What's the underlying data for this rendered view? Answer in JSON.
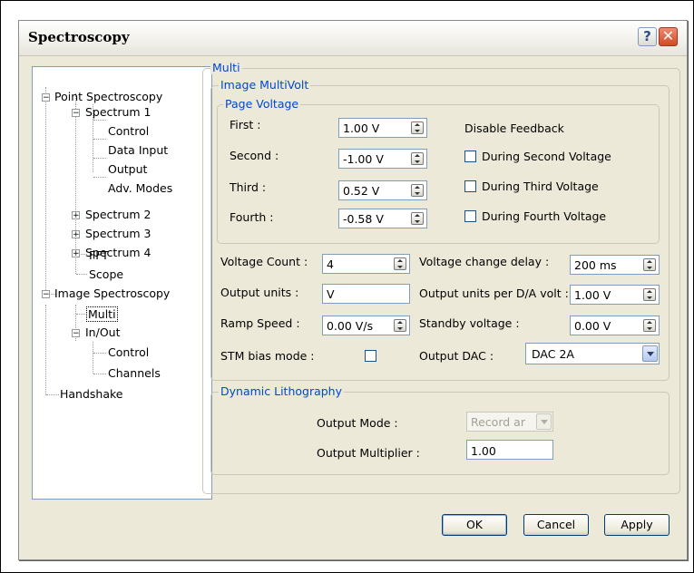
{
  "window": {
    "title": "Spectroscopy",
    "help_label": "?",
    "close_label": "✕"
  },
  "tree": {
    "point_spectroscopy": "Point Spectroscopy",
    "spectrum1": "Spectrum 1",
    "control": "Control",
    "data_input": "Data Input",
    "output": "Output",
    "adv_modes": "Adv. Modes",
    "spectrum2": "Spectrum 2",
    "spectrum3": "Spectrum 3",
    "spectrum4": "Spectrum 4",
    "fft": "FFT",
    "scope": "Scope",
    "image_spectroscopy": "Image Spectroscopy",
    "multi": "Multi",
    "in_out": "In/Out",
    "in_out_control": "Control",
    "channels": "Channels",
    "handshake": "Handshake"
  },
  "multi": {
    "group": "Multi",
    "image_multivolt": "Image MultiVolt",
    "page_voltage": "Page Voltage",
    "first_label": "First :",
    "first_value": "1.00 V",
    "second_label": "Second :",
    "second_value": "-1.00 V",
    "third_label": "Third :",
    "third_value": "0.52 V",
    "fourth_label": "Fourth :",
    "fourth_value": "-0.58 V",
    "disable_feedback": "Disable Feedback",
    "during_second": "During Second Voltage",
    "during_third": "During Third Voltage",
    "during_fourth": "During Fourth Voltage",
    "voltage_count_label": "Voltage Count :",
    "voltage_count_value": "4",
    "voltage_change_delay_label": "Voltage change delay :",
    "voltage_change_delay_value": "200 ms",
    "output_units_label": "Output units :",
    "output_units_value": "V",
    "output_units_per_da_label": "Output units per D/A volt :",
    "output_units_per_da_value": "1.00 V",
    "ramp_speed_label": "Ramp Speed :",
    "ramp_speed_value": "0.00 V/s",
    "standby_voltage_label": "Standby voltage :",
    "standby_voltage_value": "0.00 V",
    "stm_bias_mode_label": "STM bias mode :",
    "output_dac_label": "Output DAC :",
    "output_dac_value": "DAC 2A"
  },
  "lithography": {
    "group": "Dynamic Lithography",
    "output_mode_label": "Output Mode :",
    "output_mode_value": "Record ar",
    "output_multiplier_label": "Output Multiplier :",
    "output_multiplier_value": "1.00"
  },
  "buttons": {
    "ok": "OK",
    "cancel": "Cancel",
    "apply": "Apply"
  }
}
